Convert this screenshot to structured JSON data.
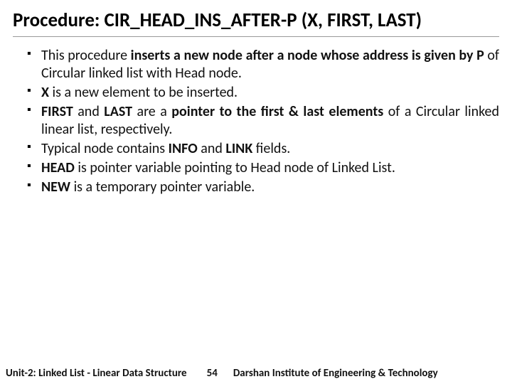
{
  "title": "Procedure: CIR_HEAD_INS_AFTER-P (X, FIRST, LAST)",
  "bullets": [
    {
      "html": "This procedure <b>inserts a new node  after a node whose address is given by P</b> of Circular linked list with Head node."
    },
    {
      "html": "<b>X</b> is a new element to be inserted."
    },
    {
      "html": "<b>FIRST</b> and <b>LAST</b> are a <b>pointer to the first &amp; last elements</b> of a Circular linked linear list, respectively."
    },
    {
      "html": "Typical node contains <b>INFO</b> and <b>LINK</b> fields."
    },
    {
      "html": "<b>HEAD</b> is pointer variable pointing to Head node of Linked List."
    },
    {
      "html": "<b>NEW</b> is a temporary pointer variable."
    }
  ],
  "footer": {
    "left": "Unit-2: Linked List - Linear Data Structure",
    "page": "54",
    "right": "Darshan Institute of Engineering & Technology"
  }
}
